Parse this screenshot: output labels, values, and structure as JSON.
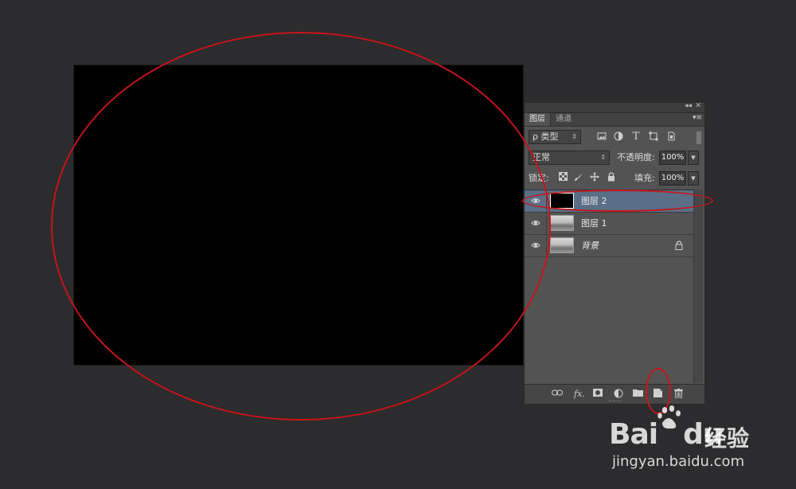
{
  "panel": {
    "top_controls": {
      "collapse": "◂◂",
      "close": "✕"
    },
    "tabs": [
      {
        "label": "图层"
      },
      {
        "label": "通道"
      }
    ],
    "menu": "▾≡",
    "filter": {
      "label": "ρ 类型",
      "icons": [
        "image-filter-icon",
        "adjustment-filter-icon",
        "type-filter-icon",
        "shape-filter-icon",
        "smart-object-filter-icon"
      ]
    },
    "blend_mode": "正常",
    "opacity_label": "不透明度:",
    "opacity_value": "100%",
    "lock_label": "锁定:",
    "fill_label": "填充:",
    "fill_value": "100%",
    "layers": [
      {
        "name": "图层 2",
        "selected": true,
        "thumb": "black"
      },
      {
        "name": "图层 1",
        "selected": false,
        "thumb": "photo"
      },
      {
        "name": "背景",
        "selected": false,
        "thumb": "photo",
        "locked": true
      }
    ],
    "bottom_icons": [
      "link-layers-icon",
      "fx-icon",
      "mask-icon",
      "adjustment-layer-icon",
      "group-folder-icon",
      "new-layer-icon",
      "trash-icon"
    ],
    "fx_text": "fx."
  },
  "watermark": {
    "brand": "Bai",
    "brand2": "du",
    "cn": "经验",
    "url": "jingyan.baidu.com"
  },
  "annotation_color": "#c4151b"
}
